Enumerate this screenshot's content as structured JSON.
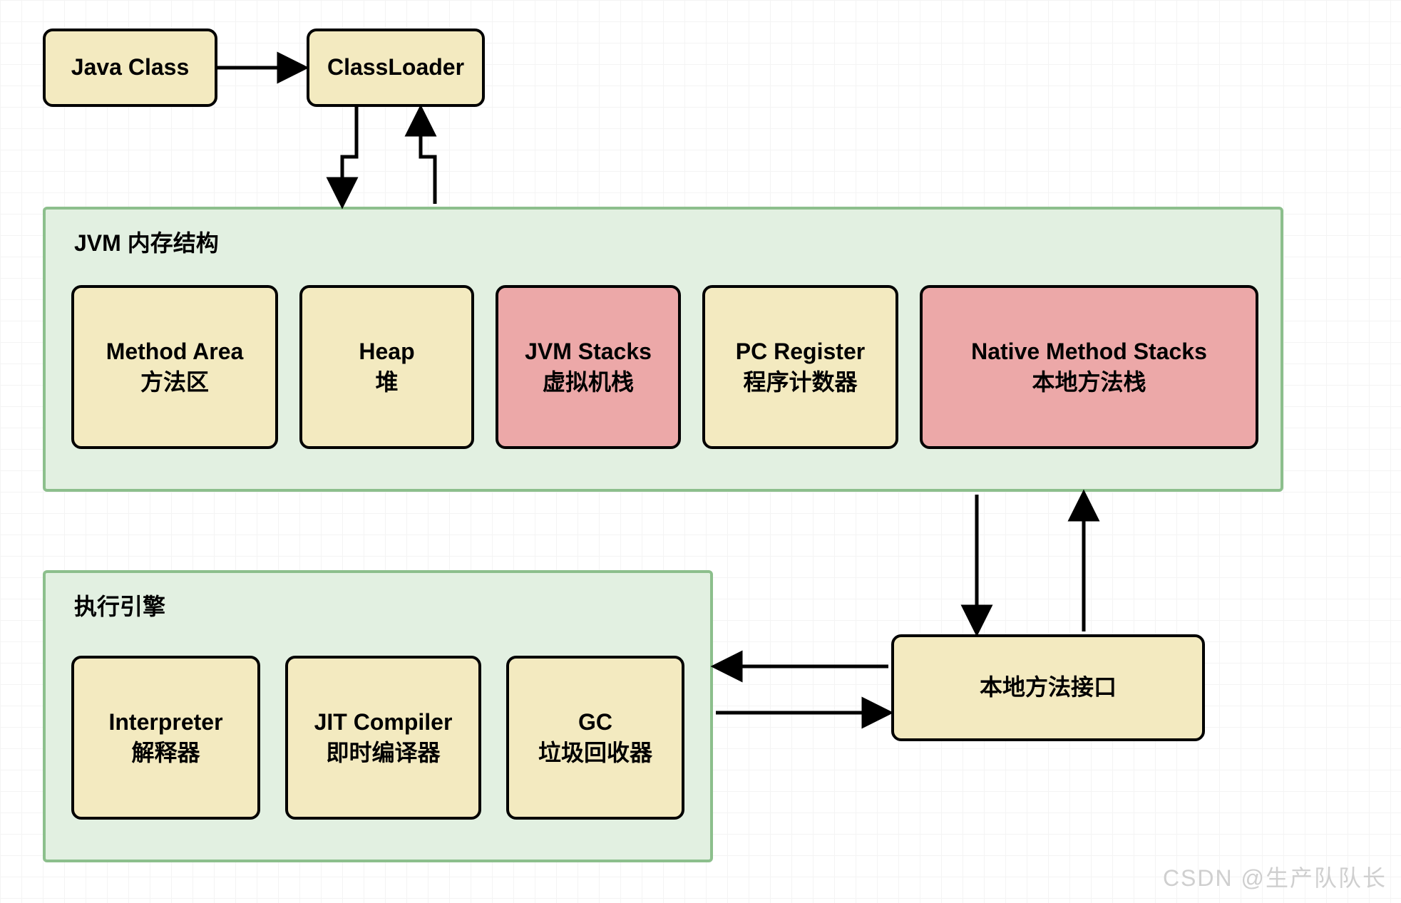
{
  "top": {
    "javaClass": "Java Class",
    "classLoader": "ClassLoader"
  },
  "memory": {
    "title": "JVM 内存结构",
    "methodArea": {
      "en": "Method Area",
      "zh": "方法区"
    },
    "heap": {
      "en": "Heap",
      "zh": "堆"
    },
    "jvmStacks": {
      "en": "JVM Stacks",
      "zh": "虚拟机栈"
    },
    "pcRegister": {
      "en": "PC Register",
      "zh": "程序计数器"
    },
    "nativeStacks": {
      "en": "Native Method Stacks",
      "zh": "本地方法栈"
    }
  },
  "engine": {
    "title": "执行引擎",
    "interpreter": {
      "en": "Interpreter",
      "zh": "解释器"
    },
    "jit": {
      "en": "JIT Compiler",
      "zh": "即时编译器"
    },
    "gc": {
      "en": "GC",
      "zh": "垃圾回收器"
    }
  },
  "nativeInterface": "本地方法接口",
  "watermark": "CSDN @生产队队长"
}
